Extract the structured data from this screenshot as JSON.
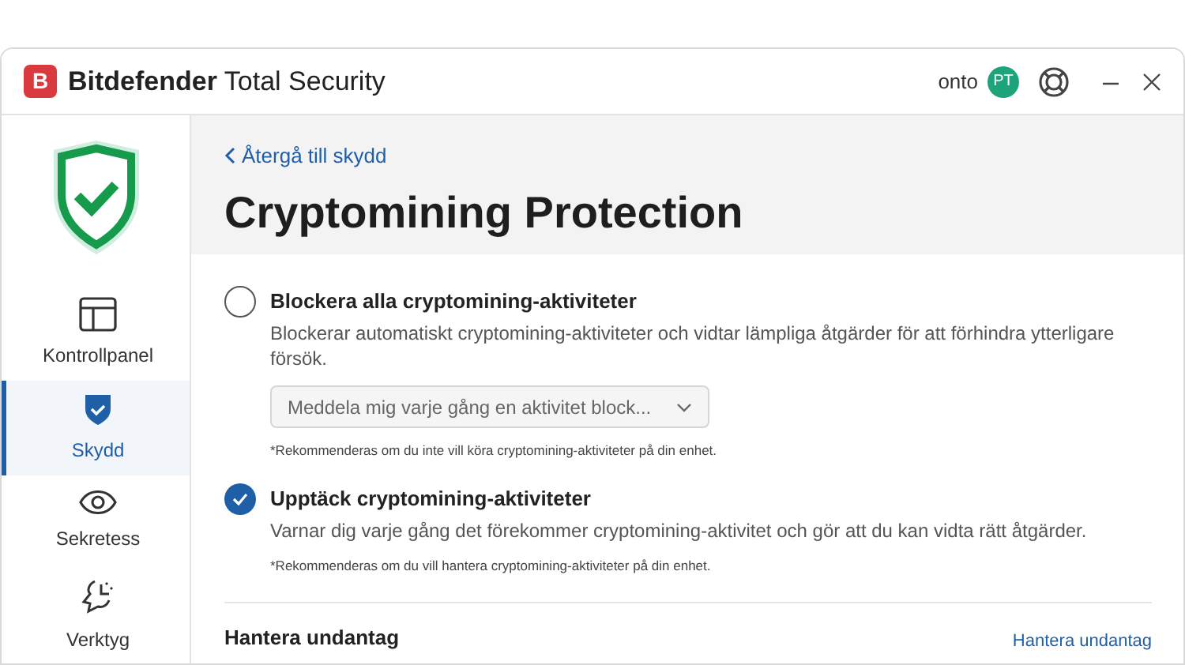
{
  "window": {
    "logo_letter": "B",
    "brand": "Bitdefender",
    "product": "Total Security",
    "account": "onto",
    "avatar": "PT"
  },
  "sidebar": {
    "items": [
      {
        "kind": "dashboard",
        "label": "Kontrollpanel",
        "selected": false
      },
      {
        "kind": "protection",
        "label": "Skydd",
        "selected": true
      },
      {
        "kind": "privacy",
        "label": "Sekretess",
        "selected": false
      },
      {
        "kind": "tools",
        "label": "Verktyg",
        "selected": false
      }
    ]
  },
  "back_link": "Återgå till skydd",
  "title": "Cryptomining Protection",
  "options": [
    {
      "title": "Blockera alla cryptomining-aktiviteter",
      "description": "Blockerar automatiskt cryptomining-aktiviteter och vidtar lämpliga åtgärder för att förhindra ytterligare försök.",
      "dropdown": {
        "value": "Meddela mig varje gång en aktivitet block...",
        "disabled": true
      },
      "note": "*Rekommenderas om du inte vill köra cryptomining-aktiviteter på din enhet.",
      "selected": false
    },
    {
      "title": "Upptäck cryptomining-aktiviteter",
      "description": "Varnar dig varje gång det förekommer cryptomining-aktivitet och gör att du kan vidta rätt åtgärder.",
      "note": "*Rekommenderas om du vill hantera cryptomining-aktiviteter på din enhet.",
      "selected": true
    }
  ],
  "exceptions": {
    "heading": "Hantera undantag",
    "link": "Hantera undantag"
  }
}
